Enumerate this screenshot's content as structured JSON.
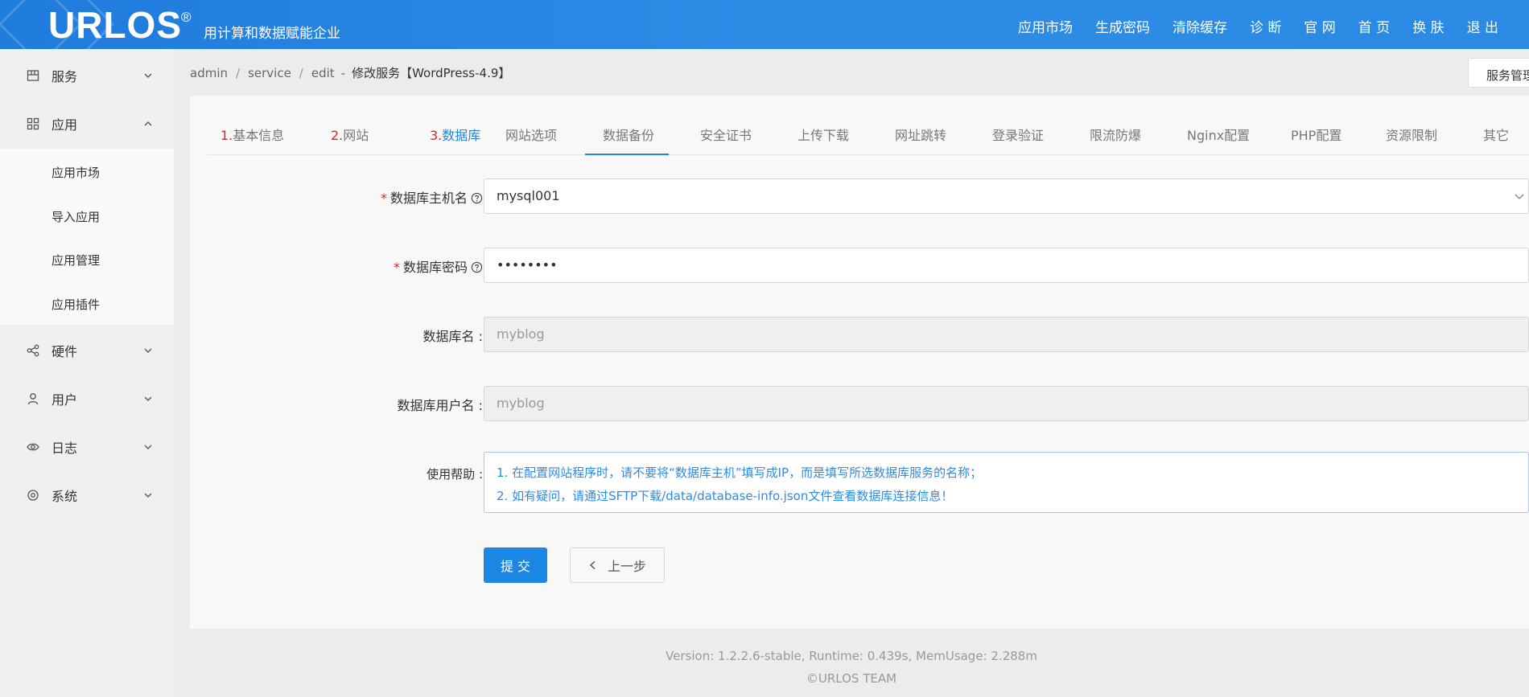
{
  "header": {
    "logo": "URLOS",
    "logo_mark": "®",
    "slogan": "用计算和数据赋能企业",
    "nav": [
      "应用市场",
      "生成密码",
      "清除缓存",
      "诊 断",
      "官 网",
      "首 页",
      "换 肤",
      "退 出"
    ]
  },
  "sidebar": {
    "items": [
      {
        "label": "服务",
        "icon": "grid-box-icon",
        "expanded": false
      },
      {
        "label": "应用",
        "icon": "apps-icon",
        "expanded": true
      },
      {
        "label": "硬件",
        "icon": "share-icon",
        "expanded": false
      },
      {
        "label": "用户",
        "icon": "user-icon",
        "expanded": false
      },
      {
        "label": "日志",
        "icon": "eye-icon",
        "expanded": false
      },
      {
        "label": "系统",
        "icon": "settings-icon",
        "expanded": false
      }
    ],
    "submenu": [
      "应用市场",
      "导入应用",
      "应用管理",
      "应用插件"
    ]
  },
  "breadcrumb": {
    "parts": [
      "admin",
      "service",
      "edit"
    ],
    "title": "修改服务【WordPress-4.9】"
  },
  "service_button": "服务管理",
  "tabs": [
    {
      "num": "1.",
      "label": "基本信息"
    },
    {
      "num": "2.",
      "label": "网站"
    },
    {
      "num": "3.",
      "label": "数据库"
    },
    {
      "num": "",
      "label": "网站选项"
    },
    {
      "num": "",
      "label": "数据备份"
    },
    {
      "num": "",
      "label": "安全证书"
    },
    {
      "num": "",
      "label": "上传下载"
    },
    {
      "num": "",
      "label": "网址跳转"
    },
    {
      "num": "",
      "label": "登录验证"
    },
    {
      "num": "",
      "label": "限流防爆"
    },
    {
      "num": "",
      "label": "Nginx配置"
    },
    {
      "num": "",
      "label": "PHP配置"
    },
    {
      "num": "",
      "label": "资源限制"
    },
    {
      "num": "",
      "label": "其它"
    }
  ],
  "active_tab": "数据库",
  "form": {
    "db_host": {
      "label": "数据库主机名",
      "required": "*",
      "value": "mysql001"
    },
    "db_password": {
      "label": "数据库密码",
      "required": "*",
      "value": "••••••••"
    },
    "db_name": {
      "label": "数据库名 :",
      "value": "myblog"
    },
    "db_user": {
      "label": "数据库用户名 :",
      "value": "myblog"
    },
    "help": {
      "label": "使用帮助 :",
      "lines": [
        "1. 在配置网站程序时，请不要将“数据库主机”填写成IP，而是填写所选数据库服务的名称；",
        "2. 如有疑问，请通过SFTP下载/data/database-info.json文件查看数据库连接信息！"
      ]
    },
    "submit": "提 交",
    "prev": "上一步"
  },
  "footer": {
    "line1": "Version: 1.2.2.6-stable,   Runtime: 0.439s,   MemUsage: 2.288m",
    "line2": "©URLOS TEAM"
  }
}
